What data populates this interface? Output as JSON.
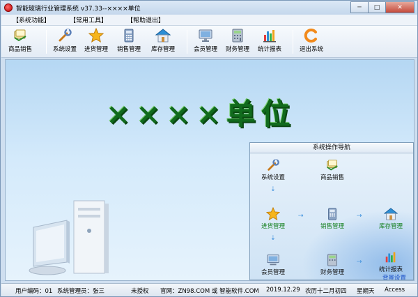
{
  "window": {
    "title": "智能玻璃行业管理系统 v37.33--××××单位",
    "controls": {
      "minimize": "─",
      "maximize": "□",
      "close": "✕"
    }
  },
  "menu": [
    "【系统功能】",
    "【常用工具】",
    "【帮助退出】"
  ],
  "toolbar": [
    {
      "label": "商品销售",
      "icon": "sales-icon"
    },
    {
      "label": "系统设置",
      "icon": "settings-icon"
    },
    {
      "label": "进货管理",
      "icon": "star-icon"
    },
    {
      "label": "销售管理",
      "icon": "calculator-icon"
    },
    {
      "label": "库存管理",
      "icon": "warehouse-icon"
    },
    {
      "label": "会员管理",
      "icon": "monitor-icon"
    },
    {
      "label": "财务管理",
      "icon": "finance-icon"
    },
    {
      "label": "统计报表",
      "icon": "chart-icon"
    },
    {
      "label": "退出系统",
      "icon": "exit-icon"
    }
  ],
  "main": {
    "brand": "××××单位"
  },
  "nav": {
    "title": "系统操作导航",
    "items": {
      "settings": "系统设置",
      "sales": "商品销售",
      "purchase": "进货管理",
      "sales_mgmt": "销售管理",
      "inventory": "库存管理",
      "member": "会员管理",
      "finance": "财务管理",
      "report": "统计报表",
      "background": "背景设置"
    }
  },
  "status": {
    "user_code": "用户编码：01",
    "admin": "系统管理员：张三",
    "license": "未授权",
    "website": "官网：ZN98.COM 或 智能软件.COM",
    "date": "2019.12.29",
    "lunar": "农历十二月初四",
    "weekday": "星期天",
    "db": "Access"
  },
  "colors": {
    "brand_green": "#116b1d",
    "nav_green": "#15801f",
    "nav_blue": "#1a50c8"
  }
}
